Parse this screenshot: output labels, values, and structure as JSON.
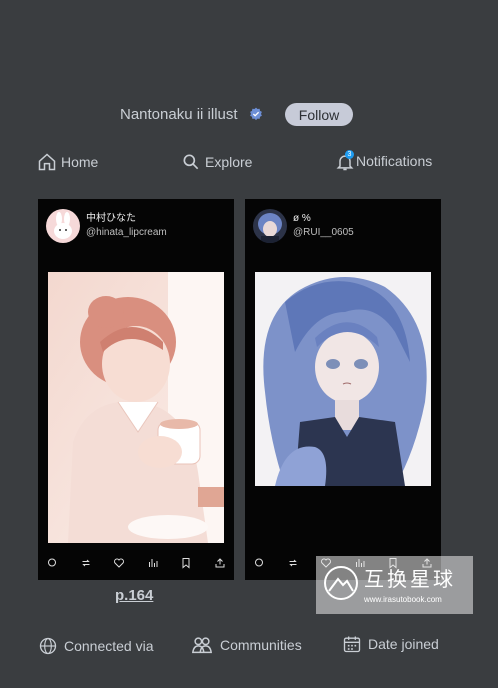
{
  "profile": {
    "name": "Nantonaku ii illust",
    "follow_label": "Follow"
  },
  "nav": {
    "home": "Home",
    "explore": "Explore",
    "notifications": "Notifications",
    "notification_count": "3"
  },
  "posts": [
    {
      "name": "中村ひなた",
      "handle": "@hinata_lipcream"
    },
    {
      "name": "ø %",
      "handle": "@RUI__0605"
    }
  ],
  "page": {
    "number": "p.164"
  },
  "watermark": {
    "title": "互换星球",
    "url": "www.irasutobook.com"
  },
  "info": {
    "connected": "Connected via",
    "communities": "Communities",
    "date_joined": "Date joined"
  },
  "colors": {
    "background": "#3a3d40",
    "accent": "#1d9bf0",
    "follow_bg": "#c7cbd8"
  }
}
